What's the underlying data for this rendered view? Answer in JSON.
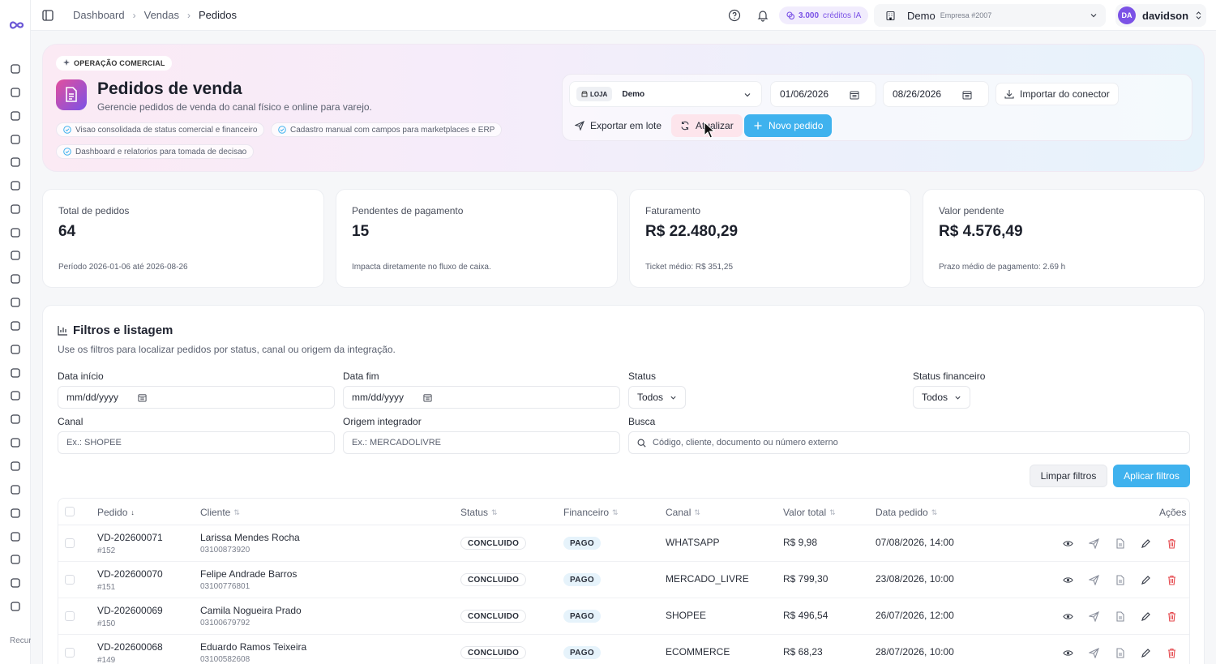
{
  "sidebar": {
    "icons": [
      "dashboard-icon",
      "wrench-icon",
      "users-icon",
      "bike-icon",
      "trending-icon",
      "broadcast-icon",
      "card-icon",
      "cart-icon",
      "ship-icon",
      "database-icon",
      "box-icon",
      "package-icon",
      "megaphone-icon",
      "briefcase-icon",
      "headset-icon",
      "contacts-icon",
      "folder-icon",
      "calculator-icon",
      "command-icon",
      "settings-icon",
      "truck-icon",
      "robot-icon",
      "receipt-icon",
      "report-icon"
    ],
    "footer": "Recursos avançados"
  },
  "topbar": {
    "breadcrumbs": [
      "Dashboard",
      "Vendas",
      "Pedidos"
    ],
    "credits_amount": "3.000",
    "credits_label": "créditos IA",
    "company_name": "Demo",
    "company_sub": "Empresa #2007",
    "user_initials": "DA",
    "user_name": "davidson"
  },
  "hero": {
    "badge": "OPERAÇÃO COMERCIAL",
    "title": "Pedidos de venda",
    "subtitle": "Gerencie pedidos de venda do canal físico e online para varejo.",
    "chips": [
      "Visao consolidada de status comercial e financeiro",
      "Cadastro manual com campos para marketplaces e ERP",
      "Dashboard e relatorios para tomada de decisao"
    ],
    "store_tag": "LOJA",
    "store_value": "Demo",
    "date_start": "01/06/2026",
    "date_end": "08/26/2026",
    "import_label": "Importar do conector",
    "export_label": "Exportar em lote",
    "refresh_label": "Atualizar",
    "new_label": "Novo pedido"
  },
  "stats": [
    {
      "label": "Total de pedidos",
      "value": "64",
      "footer": "Período 2026-01-06 até 2026-08-26"
    },
    {
      "label": "Pendentes de pagamento",
      "value": "15",
      "footer": "Impacta diretamente no fluxo de caixa."
    },
    {
      "label": "Faturamento",
      "value": "R$ 22.480,29",
      "footer": "Ticket médio: R$ 351,25"
    },
    {
      "label": "Valor pendente",
      "value": "R$ 4.576,49",
      "footer": "Prazo médio de pagamento: 2.69 h"
    }
  ],
  "filters": {
    "title": "Filtros e listagem",
    "subtitle": "Use os filtros para localizar pedidos por status, canal ou origem da integração.",
    "date_start_label": "Data início",
    "date_start_placeholder": "mm/dd/yyyy",
    "date_end_label": "Data fim",
    "date_end_placeholder": "mm/dd/yyyy",
    "status_label": "Status",
    "status_value": "Todos",
    "fin_status_label": "Status financeiro",
    "fin_status_value": "Todos",
    "channel_label": "Canal",
    "channel_placeholder": "Ex.: SHOPEE",
    "origin_label": "Origem integrador",
    "origin_placeholder": "Ex.: MERCADOLIVRE",
    "search_label": "Busca",
    "search_placeholder": "Código, cliente, documento ou número externo",
    "clear_label": "Limpar filtros",
    "apply_label": "Aplicar filtros"
  },
  "table": {
    "headers": [
      "Pedido",
      "Cliente",
      "Status",
      "Financeiro",
      "Canal",
      "Valor total",
      "Data pedido",
      "Ações"
    ],
    "rows": [
      {
        "order": "VD-202600071",
        "num": "#152",
        "client": "Larissa Mendes Rocha",
        "doc": "03100873920",
        "status": "CONCLUIDO",
        "fin": "PAGO",
        "channel": "WHATSAPP",
        "total": "R$ 9,98",
        "date": "07/08/2026, 14:00"
      },
      {
        "order": "VD-202600070",
        "num": "#151",
        "client": "Felipe Andrade Barros",
        "doc": "03100776801",
        "status": "CONCLUIDO",
        "fin": "PAGO",
        "channel": "MERCADO_LIVRE",
        "total": "R$ 799,30",
        "date": "23/08/2026, 10:00"
      },
      {
        "order": "VD-202600069",
        "num": "#150",
        "client": "Camila Nogueira Prado",
        "doc": "03100679792",
        "status": "CONCLUIDO",
        "fin": "PAGO",
        "channel": "SHOPEE",
        "total": "R$ 496,54",
        "date": "26/07/2026, 12:00"
      },
      {
        "order": "VD-202600068",
        "num": "#149",
        "client": "Eduardo Ramos Teixeira",
        "doc": "03100582608",
        "status": "CONCLUIDO",
        "fin": "PAGO",
        "channel": "ECOMMERCE",
        "total": "R$ 68,23",
        "date": "28/07/2026, 10:00"
      }
    ]
  },
  "colors": {
    "accent": "#3fb2ee",
    "purple": "#7b52e6",
    "danger": "#e5484d"
  }
}
